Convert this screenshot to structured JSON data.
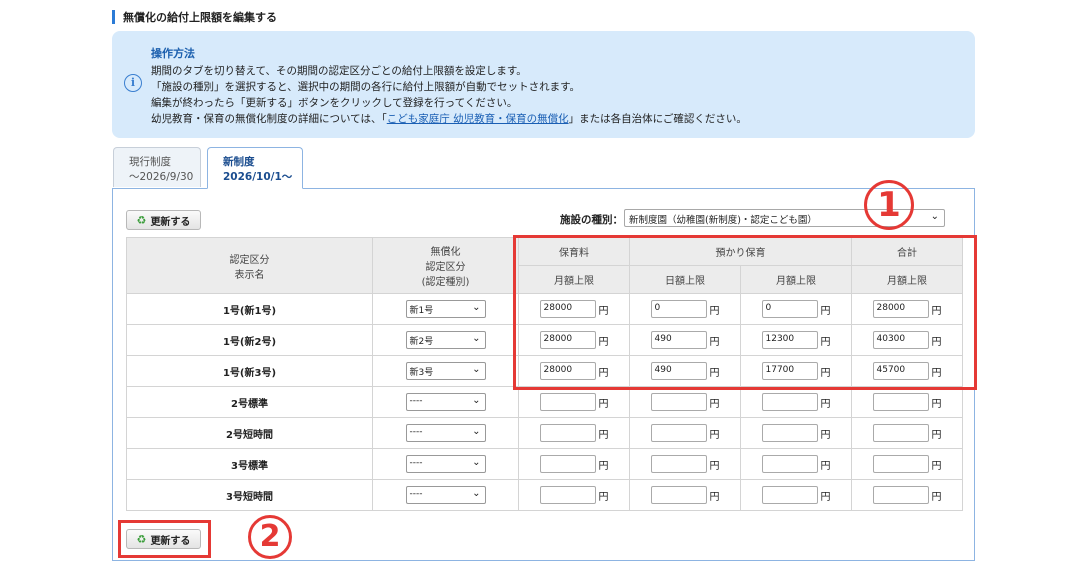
{
  "section_title": "無償化の給付上限額を編集する",
  "info": {
    "title": "操作方法",
    "lines": [
      "期間のタブを切り替えて、その期間の認定区分ごとの給付上限額を設定します。",
      "「施設の種別」を選択すると、選択中の期間の各行に給付上限額が自動でセットされます。",
      "編集が終わったら「更新する」ボタンをクリックして登録を行ってください。"
    ],
    "line4_prefix": "幼児教育・保育の無償化制度の詳細については、「",
    "line4_link": "こども家庭庁 幼児教育・保育の無償化",
    "line4_suffix": "」または各自治体にご確認ください。"
  },
  "tabs": [
    {
      "line1": "現行制度",
      "line2": "～2026/9/30"
    },
    {
      "line1": "新制度",
      "line2": "2026/10/1～"
    }
  ],
  "update_button": "更新する",
  "facility": {
    "label": "施設の種別：",
    "value": "新制度園（幼稚園(新制度)・認定こども園）"
  },
  "table": {
    "h_name": [
      "認定区分",
      "表示名"
    ],
    "h_cat": [
      "無償化",
      "認定区分",
      "(認定種別)"
    ],
    "h_hoiku": "保育料",
    "h_azukari": "預かり保育",
    "h_total": "合計",
    "h_monthly": "月額上限",
    "h_daily": "日額上限",
    "yen": "円",
    "rows": [
      {
        "name": "1号(新1号)",
        "cat": "新1号",
        "hoiku": "28000",
        "daily": "0",
        "monthly": "0",
        "total": "28000"
      },
      {
        "name": "1号(新2号)",
        "cat": "新2号",
        "hoiku": "28000",
        "daily": "490",
        "monthly": "12300",
        "total": "40300"
      },
      {
        "name": "1号(新3号)",
        "cat": "新3号",
        "hoiku": "28000",
        "daily": "490",
        "monthly": "17700",
        "total": "45700"
      },
      {
        "name": "2号標準",
        "cat": "----",
        "hoiku": "",
        "daily": "",
        "monthly": "",
        "total": ""
      },
      {
        "name": "2号短時間",
        "cat": "----",
        "hoiku": "",
        "daily": "",
        "monthly": "",
        "total": ""
      },
      {
        "name": "3号標準",
        "cat": "----",
        "hoiku": "",
        "daily": "",
        "monthly": "",
        "total": ""
      },
      {
        "name": "3号短時間",
        "cat": "----",
        "hoiku": "",
        "daily": "",
        "monthly": "",
        "total": ""
      }
    ]
  },
  "annotations": {
    "one": "①",
    "two": "②"
  },
  "icons": {
    "info": "info-circle-icon",
    "refresh": "refresh-icon",
    "chevron": "chevron-down-icon"
  },
  "colors": {
    "accent": "#2b7bd6",
    "info_bg": "#d7eafb",
    "annotation_red": "#e53935"
  }
}
